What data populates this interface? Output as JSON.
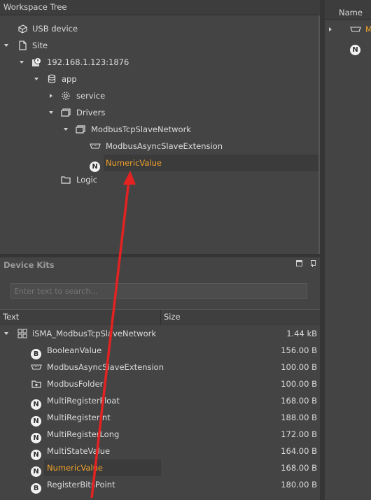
{
  "workspace_tree": {
    "title": "Workspace Tree",
    "items": [
      {
        "label": "USB device"
      },
      {
        "label": "Site"
      },
      {
        "label": "192.168.1.123:1876"
      },
      {
        "label": "app"
      },
      {
        "label": "service"
      },
      {
        "label": "Drivers"
      },
      {
        "label": "ModbusTcpSlaveNetwork"
      },
      {
        "label": "ModbusAsyncSlaveExtension"
      },
      {
        "label": "NumericValue",
        "badge": "N"
      },
      {
        "label": "Logic"
      }
    ]
  },
  "right_panel": {
    "column_header": "Name",
    "items": [
      {
        "label": "M"
      },
      {
        "label": "N",
        "badge": "N"
      }
    ]
  },
  "device_kits": {
    "title": "Device Kits",
    "search": {
      "placeholder": "Enter text to search..."
    },
    "columns": {
      "text": "Text",
      "size": "Size"
    },
    "kit": {
      "label": "iSMA_ModbusTcpSlaveNetwork",
      "size": "1.44 kB"
    },
    "items": [
      {
        "label": "BooleanValue",
        "badge": "B",
        "size": "156.00 B"
      },
      {
        "label": "ModbusAsyncSlaveExtension",
        "size": "100.00 B"
      },
      {
        "label": "ModbusFolder",
        "size": "100.00 B"
      },
      {
        "label": "MultiRegisterFloat",
        "badge": "N",
        "size": "168.00 B"
      },
      {
        "label": "MultiRegisterInt",
        "badge": "N",
        "size": "188.00 B"
      },
      {
        "label": "MultiRegisterLong",
        "badge": "N",
        "size": "172.00 B"
      },
      {
        "label": "MultiStateValue",
        "badge": "N",
        "size": "164.00 B"
      },
      {
        "label": "NumericValue",
        "badge": "N",
        "size": "168.00 B"
      },
      {
        "label": "RegisterBitsPoint",
        "badge": "B",
        "size": "180.00 B"
      }
    ]
  },
  "colors": {
    "accent": "#f0a22a",
    "arrow": "#e32222",
    "panel_bg": "#444444"
  }
}
